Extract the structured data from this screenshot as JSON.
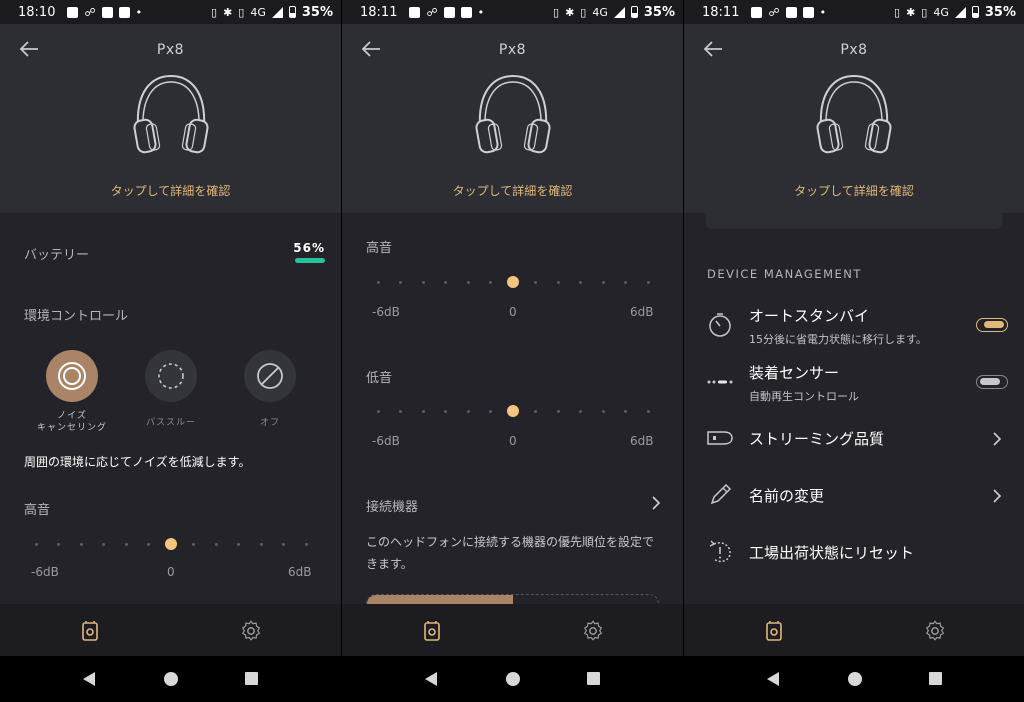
{
  "screens": [
    {
      "status": {
        "time": "18:10",
        "network": "4G",
        "battery": "35%"
      },
      "header": {
        "title": "Px8",
        "tap_link": "タップして詳細を確認"
      },
      "battery": {
        "label": "バッテリー",
        "value": "56%",
        "level_percent": 56
      },
      "ambient": {
        "label": "環境コントロール",
        "modes": [
          {
            "label": "ノイズ\nキャンセリング",
            "active": true
          },
          {
            "label": "パススルー",
            "active": false
          },
          {
            "label": "オフ",
            "active": false
          }
        ],
        "description": "周囲の環境に応じてノイズを低減します。"
      },
      "treble": {
        "label": "高音",
        "min": "-6dB",
        "mid": "0",
        "max": "6dB",
        "value_db": 0
      }
    },
    {
      "status": {
        "time": "18:11",
        "network": "4G",
        "battery": "35%"
      },
      "header": {
        "title": "Px8",
        "tap_link": "タップして詳細を確認"
      },
      "treble": {
        "label": "高音",
        "min": "-6dB",
        "mid": "0",
        "max": "6dB",
        "value_db": 0
      },
      "bass": {
        "label": "低音",
        "min": "-6dB",
        "mid": "0",
        "max": "6dB",
        "value_db": 0
      },
      "connected": {
        "label": "接続機器",
        "description": "このヘッドフォンに接続する機器の優先順位を設定できます。"
      }
    },
    {
      "status": {
        "time": "18:11",
        "network": "4G",
        "battery": "35%"
      },
      "header": {
        "title": "Px8",
        "tap_link": "タップして詳細を確認"
      },
      "section_title": "DEVICE MANAGEMENT",
      "rows": [
        {
          "title": "オートスタンバイ",
          "subtitle": "15分後に省電力状態に移行します。",
          "toggle": "on",
          "icon": "timer-icon"
        },
        {
          "title": "装着センサー",
          "subtitle": "自動再生コントロール",
          "toggle": "off",
          "icon": "wear-sensor-icon"
        },
        {
          "title": "ストリーミング品質",
          "icon": "streaming-icon"
        },
        {
          "title": "名前の変更",
          "icon": "pencil-icon"
        },
        {
          "title": "工場出荷状態にリセット",
          "icon": "reset-icon"
        }
      ]
    }
  ],
  "colors": {
    "accent": "#e0b87a",
    "active_mode": "#a98467",
    "battery_bar": "#26c29b",
    "background": "#232329"
  }
}
